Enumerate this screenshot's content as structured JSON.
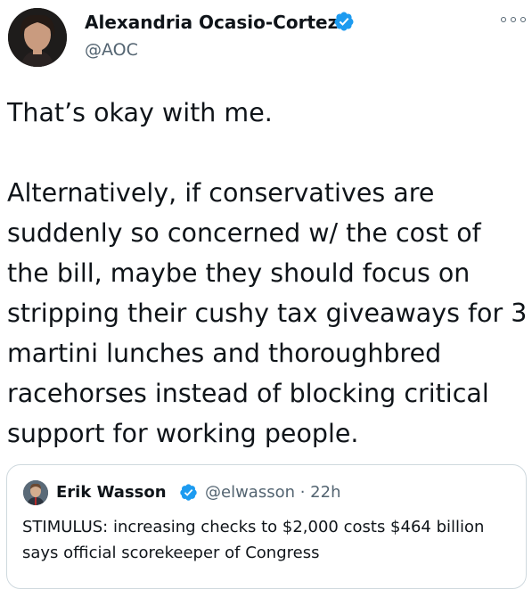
{
  "author": {
    "name": "Alexandria Ocasio-Cortez",
    "handle": "@AOC"
  },
  "tweet": {
    "text": "That’s okay with me.\n\nAlternatively, if conservatives are suddenly so concerned w/ the cost of the bill, maybe they should focus on stripping their cushy tax giveaways for 3 martini lunches and thoroughbred racehorses instead of blocking critical support for working people."
  },
  "quoted_tweet": {
    "name": "Erik Wasson",
    "handle_time": "@elwasson · 22h",
    "text": "STIMULUS: increasing checks to $2,000 costs $464 billion says official scorekeeper of Congress"
  },
  "colors": {
    "verified": "#1d9bf0",
    "secondary_text": "#536471",
    "border": "#cfd9de"
  },
  "icons": [
    "verified-badge-icon",
    "more-options-icon"
  ]
}
